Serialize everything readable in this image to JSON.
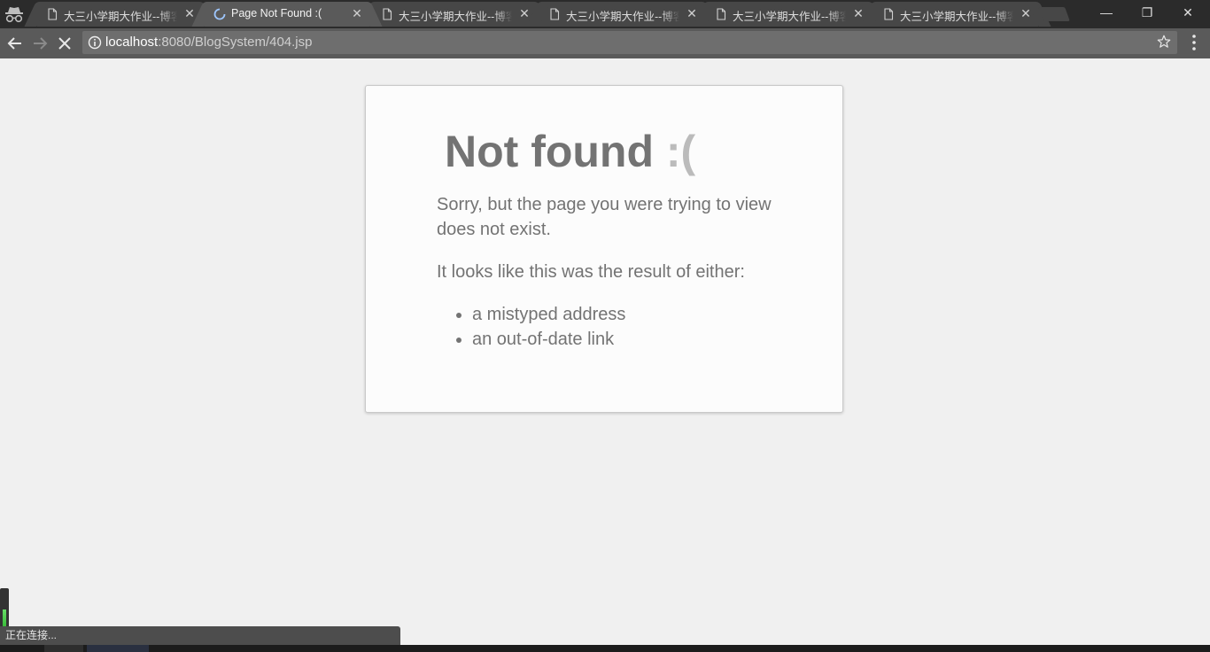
{
  "browser": {
    "tabs": [
      {
        "title": "大三小学期大作业--博客",
        "active": false,
        "loading": false
      },
      {
        "title": "Page Not Found :(",
        "active": true,
        "loading": true
      },
      {
        "title": "大三小学期大作业--博客",
        "active": false,
        "loading": false
      },
      {
        "title": "大三小学期大作业--博客",
        "active": false,
        "loading": false
      },
      {
        "title": "大三小学期大作业--博客",
        "active": false,
        "loading": false
      },
      {
        "title": "大三小学期大作业--博客",
        "active": false,
        "loading": false
      }
    ],
    "tab_close_glyph": "✕",
    "window_controls": {
      "minimize": "—",
      "restore": "❐",
      "close": "✕"
    },
    "address": {
      "host": "localhost",
      "path": ":8080/BlogSystem/404.jsp"
    },
    "status_text": "正在连接..."
  },
  "page": {
    "heading": "Not found ",
    "heading_face": ":(",
    "para1": "Sorry, but the page you were trying to view does not exist.",
    "para2": "It looks like this was the result of either:",
    "reasons": [
      "a mistyped address",
      "an out-of-date link"
    ]
  },
  "colors": {
    "tabstrip": "#2b2b2b",
    "tab_inactive": "#474747",
    "tab_active": "#5a5a5a",
    "page_bg": "#f0f0f0",
    "text": "#737373",
    "face": "#bbbbbb"
  },
  "icons": {
    "incognito": "incognito-icon",
    "page": "page-icon",
    "loading": "loading-spinner-icon",
    "back": "back-arrow-icon",
    "forward": "forward-arrow-icon",
    "stop": "stop-icon",
    "info": "info-icon",
    "star": "star-icon",
    "menu": "kebab-menu-icon"
  }
}
